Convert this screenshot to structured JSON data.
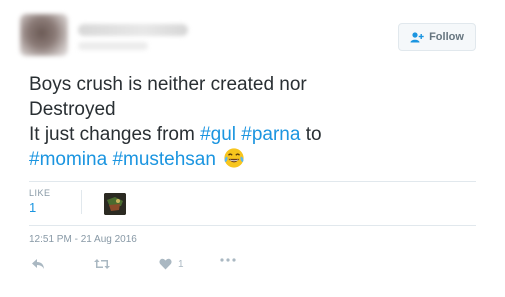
{
  "header": {
    "follow_label": "Follow"
  },
  "tweet": {
    "line1": "Boys crush is neither created nor",
    "line2": "Destroyed",
    "line3_text": "It just changes from ",
    "hashtag_gul": "#gul",
    "hashtag_parna": "#parna",
    "line3_end": " to",
    "hashtag_momina": "#momina",
    "hashtag_mustehsan": "#mustehsan",
    "emoji_name": "face-with-tears-of-joy"
  },
  "engagement": {
    "likes_label": "LIKE",
    "likes_count": "1"
  },
  "timestamp": "12:51 PM - 21 Aug 2016",
  "actions": {
    "like_count": "1"
  },
  "colors": {
    "hashtag": "#1b95e0",
    "text": "#292f33",
    "muted": "#8899a6",
    "action_icon": "#aab8c2"
  }
}
